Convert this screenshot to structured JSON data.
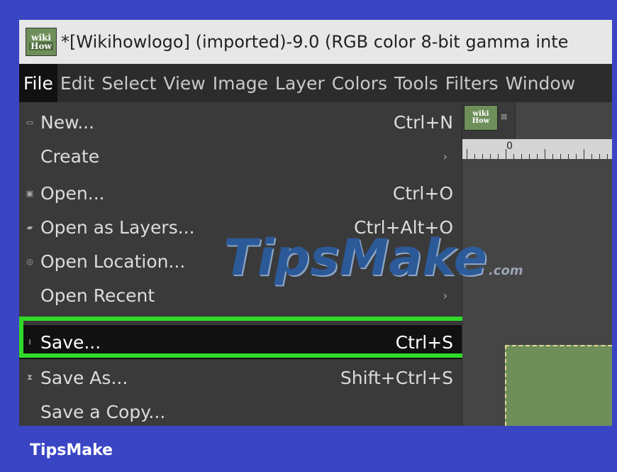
{
  "window": {
    "title": "*[Wikihowlogo] (imported)-9.0 (RGB color 8-bit gamma inte",
    "logo_line1": "wiki",
    "logo_line2": "How"
  },
  "menubar": {
    "items": [
      "File",
      "Edit",
      "Select",
      "View",
      "Image",
      "Layer",
      "Colors",
      "Tools",
      "Filters",
      "Window"
    ],
    "active": "File"
  },
  "file_menu": {
    "items": [
      {
        "label": "New...",
        "shortcut": "Ctrl+N",
        "icon": "new-document-icon"
      },
      {
        "label": "Create",
        "shortcut": "›",
        "icon": ""
      },
      {
        "label": "Open...",
        "shortcut": "Ctrl+O",
        "icon": "open-image-icon"
      },
      {
        "label": "Open as Layers...",
        "shortcut": "Ctrl+Alt+O",
        "icon": "open-layers-icon"
      },
      {
        "label": "Open Location...",
        "shortcut": "",
        "icon": "globe-icon"
      },
      {
        "label": "Open Recent",
        "shortcut": "›",
        "icon": ""
      },
      {
        "label": "Save...",
        "shortcut": "Ctrl+S",
        "icon": "save-icon",
        "highlighted": true
      },
      {
        "label": "Save As...",
        "shortcut": "Shift+Ctrl+S",
        "icon": "save-as-icon"
      },
      {
        "label": "Save a Copy...",
        "shortcut": "",
        "icon": ""
      }
    ]
  },
  "image_tab": {
    "thumb_line1": "wiki",
    "thumb_line2": "How",
    "close_glyph": "⊠"
  },
  "ruler": {
    "zero_label": "0"
  },
  "watermark": {
    "part1": "Tips",
    "part2": "Make",
    "part3": ".com"
  },
  "footer": {
    "brand": "TipsMake"
  },
  "colors": {
    "frame_bg": "#3a45c4",
    "highlight_border": "#31d928",
    "image_fill": "#6e8f5a"
  }
}
